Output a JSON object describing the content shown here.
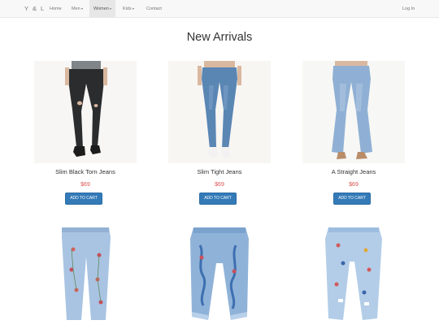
{
  "navbar": {
    "brand": "Y & L",
    "items": [
      {
        "label": "Home",
        "dropdown": false
      },
      {
        "label": "Men",
        "dropdown": true
      },
      {
        "label": "Women",
        "dropdown": true
      },
      {
        "label": "Kids",
        "dropdown": true
      },
      {
        "label": "Contact",
        "dropdown": false
      }
    ],
    "active_item": "Women",
    "login": "Log In"
  },
  "page": {
    "title": "New Arrivals"
  },
  "products": [
    {
      "name": "Slim Black Torn Jeans",
      "price": "$69",
      "button": "ADD TO CART",
      "image": "black-torn-skinny-jeans"
    },
    {
      "name": "Slim Tight Jeans",
      "price": "$69",
      "button": "ADD TO CART",
      "image": "medium-wash-skinny-jeans"
    },
    {
      "name": "A Straight Jeans",
      "price": "$69",
      "button": "ADD TO CART",
      "image": "light-wash-flare-jeans"
    },
    {
      "image": "light-embroidered-jeans"
    },
    {
      "image": "embroidered-boyfriend-jeans"
    },
    {
      "image": "patched-distressed-jeans"
    }
  ],
  "colors": {
    "accent": "#337ab7",
    "price": "#d9534f",
    "navbar_bg": "#f8f8f8"
  }
}
